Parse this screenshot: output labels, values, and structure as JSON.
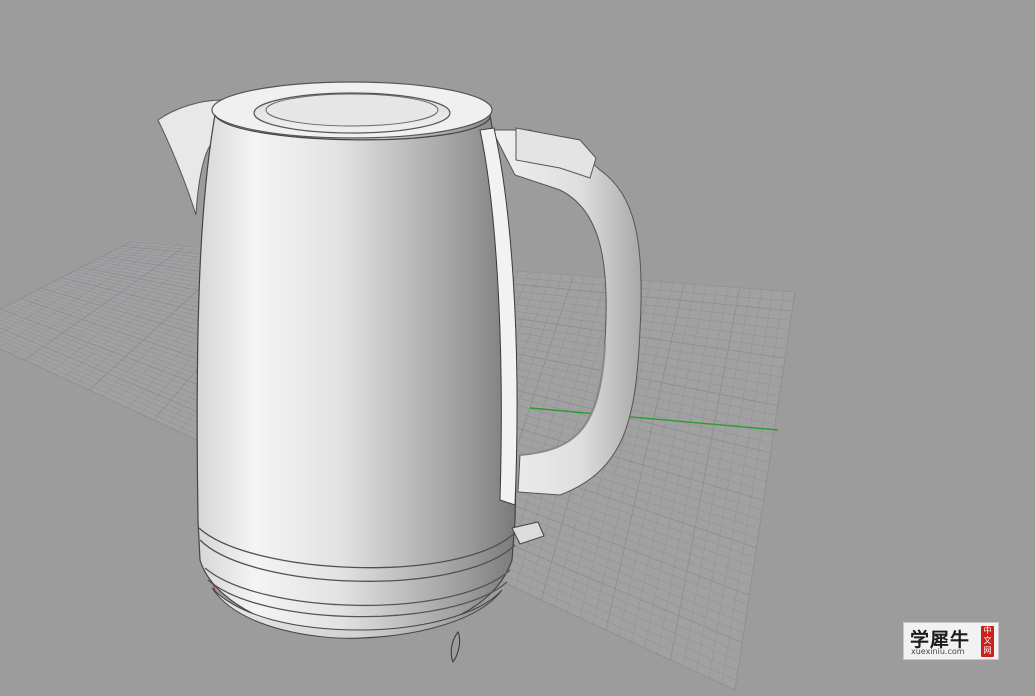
{
  "viewport": {
    "background_color": "#9c9c9c",
    "grid_line_color": "#8a8f96",
    "x_axis_color": "#b23a3a",
    "y_axis_color": "#2e9a2e",
    "model": "electric-kettle",
    "shading": "white-matte"
  },
  "watermark": {
    "brand": "学犀牛",
    "url": "xuexiniu.com",
    "stamp": "中文网"
  }
}
